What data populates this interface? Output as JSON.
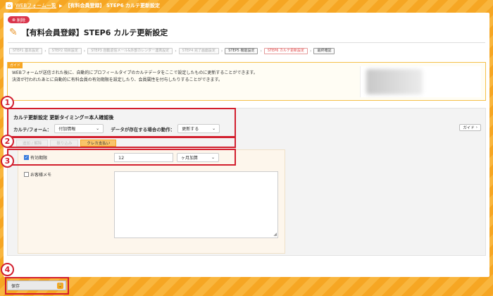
{
  "breadcrumb": {
    "home_icon": "home-icon",
    "link": "WEBフォーム一覧",
    "current": "【有料会員登録】 STEP6 カルテ更新設定"
  },
  "delete_label": "削除",
  "page_title": "【有料会員登録】STEP6 カルテ更新設定",
  "steps": [
    {
      "label": "STEP1 基本設定",
      "state": "done"
    },
    {
      "label": "STEP2 項目設定",
      "state": "done"
    },
    {
      "label": "STEP3 自動返信メール&外部カレンダー連携設定",
      "state": "done"
    },
    {
      "label": "STEP4 完了画面設定",
      "state": "done"
    },
    {
      "label": "STEP5 機能設定",
      "state": "normal"
    },
    {
      "label": "STEP6 カルテ更新設定",
      "state": "active"
    },
    {
      "label": "最終確認",
      "state": "normal"
    }
  ],
  "guide": {
    "tag": "ガイド",
    "line1": "WEBフォームが送信された後に、自動的にプロフィールタイプのカルテデータをここで設定したものに更新することができます。",
    "line2": "決済が行われたあとに自動的に有料会員の有効期限を設定したり、会員属性を付与したりすることができます。"
  },
  "karte": {
    "heading": "カルテ更新設定 更新タイミング＝本人確認後",
    "form_label": "カルテ/フォーム：",
    "form_value": "付加情報",
    "action_label": "データが存在する場合の動作：",
    "action_value": "更新する",
    "guide_button": "ガイド"
  },
  "tabs": [
    "追加 / 解除",
    "振り込み",
    "クレカ支払い"
  ],
  "fields": {
    "expiry_label": "有効期限",
    "expiry_value": "12",
    "expiry_unit": "ヶ月加算",
    "memo_label": "お客様メモ",
    "memo_value": ""
  },
  "save_label": "保存",
  "callouts": [
    "1",
    "2",
    "3",
    "4"
  ],
  "colors": {
    "accent": "#f6a623",
    "callout": "#d21f2e",
    "active_tab": "#f9c46b"
  }
}
